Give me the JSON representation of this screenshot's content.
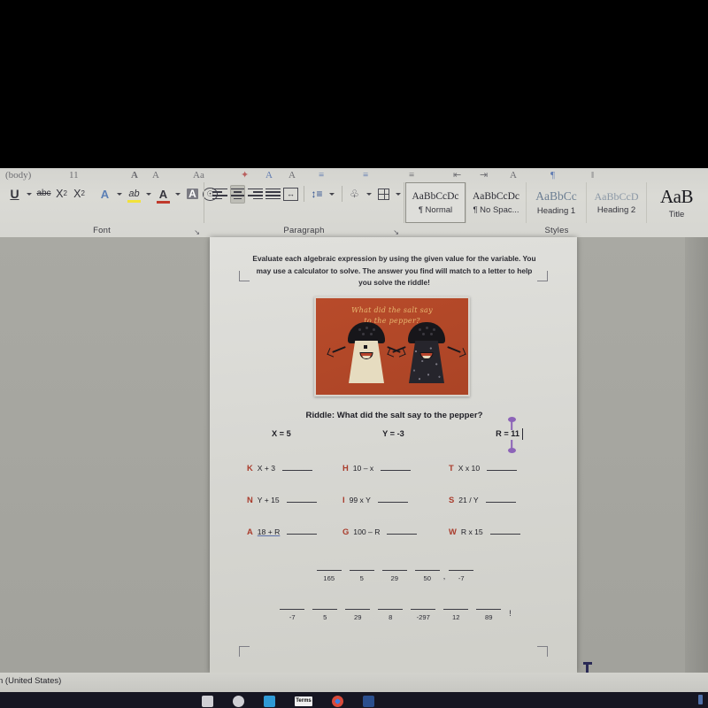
{
  "app": {
    "name": "Microsoft Word",
    "ribbon_cut_hint": "(body)"
  },
  "ribbon": {
    "groups": [
      {
        "name": "Font",
        "label": "Font",
        "dialog_launcher": "↘",
        "items": [
          {
            "icon": "underline-icon",
            "label": "U"
          },
          {
            "icon": "strikethrough-icon",
            "label": "abc"
          },
          {
            "icon": "subscript-icon",
            "label": "X"
          },
          {
            "icon": "superscript-icon",
            "label": "X"
          },
          {
            "icon": "text-effects-icon",
            "label": "A"
          },
          {
            "icon": "text-highlight-color-icon",
            "label": "ab"
          },
          {
            "icon": "font-color-icon",
            "label": "A"
          },
          {
            "icon": "character-shading-icon",
            "label": "A"
          },
          {
            "icon": "phonetic-guide-icon",
            "label": "♁"
          }
        ]
      },
      {
        "name": "Paragraph",
        "label": "Paragraph",
        "dialog_launcher": "↘",
        "items": [
          {
            "icon": "align-left-icon",
            "label": ""
          },
          {
            "icon": "align-center-icon",
            "label": ""
          },
          {
            "icon": "align-right-icon",
            "label": ""
          },
          {
            "icon": "justify-icon",
            "label": ""
          },
          {
            "icon": "distributed-icon",
            "label": "↔"
          },
          {
            "icon": "line-spacing-icon",
            "label": "↕"
          },
          {
            "icon": "shading-icon",
            "label": "◢"
          },
          {
            "icon": "borders-icon",
            "label": ""
          }
        ]
      },
      {
        "name": "Styles",
        "label": "Styles"
      }
    ],
    "styles": [
      {
        "preview": "AaBbCcDc",
        "name": "¶ Normal",
        "selected": true,
        "kind": "body"
      },
      {
        "preview": "AaBbCcDc",
        "name": "¶ No Spac...",
        "selected": false,
        "kind": "body"
      },
      {
        "preview": "AaBbCc",
        "name": "Heading 1",
        "selected": false,
        "kind": "h1"
      },
      {
        "preview": "AaBbCcD",
        "name": "Heading 2",
        "selected": false,
        "kind": "h2"
      },
      {
        "preview": "AaB",
        "name": "Title",
        "selected": false,
        "kind": "title"
      }
    ]
  },
  "document": {
    "intro": "Evaluate each algebraic expression by using the given value for the variable.  You may use a calculator to solve.  The answer you find will match to a letter to help you solve the riddle!",
    "picture": {
      "alt": "salt-and-pepper-shakers-cartoon",
      "script_line1": "What did the salt say",
      "script_line2": "to the pepper?",
      "background_color": "#b0472a",
      "script_color": "#e8b870",
      "salt_body_color": "#e6dcc0",
      "pepper_body_color": "#26252c",
      "cap_color": "#17161a"
    },
    "riddle_question": "Riddle:  What did the salt say to the pepper?",
    "variables": [
      {
        "name": "X",
        "value": "X = 5"
      },
      {
        "name": "Y",
        "value": "Y = -3"
      },
      {
        "name": "R",
        "value": "R = 11",
        "has_caret": true
      }
    ],
    "problems": [
      [
        {
          "letter": "K",
          "expression": "X + 3"
        },
        {
          "letter": "H",
          "expression": "10 – x"
        },
        {
          "letter": "T",
          "expression": "X x 10"
        }
      ],
      [
        {
          "letter": "N",
          "expression": "Y + 15"
        },
        {
          "letter": "I",
          "expression": "99 x Y"
        },
        {
          "letter": "S",
          "expression": "21 / Y"
        }
      ],
      [
        {
          "letter": "A",
          "expression": "18 + R",
          "underline_tail": "R"
        },
        {
          "letter": "G",
          "expression": "100 – R"
        },
        {
          "letter": "W",
          "expression": "R x 15"
        }
      ]
    ],
    "answer_lines": [
      {
        "numbers": [
          "165",
          "5",
          "29",
          "50",
          "-7"
        ],
        "punct_after_index": 3,
        "punct": ",",
        "terminator": ""
      },
      {
        "numbers": [
          "-7",
          "5",
          "29",
          "8",
          "-297",
          "12",
          "89"
        ],
        "punct_after_index": -1,
        "punct": "",
        "terminator": "!"
      }
    ],
    "letter_color": "#a93b2b",
    "underline_color": "#5a6ea8"
  },
  "cursor": {
    "type": "i-beam",
    "color": "#2a2a55"
  },
  "selection_handles": {
    "color": "#8c63b8"
  },
  "status_bar": {
    "language": "n (United States)"
  },
  "taskbar": {
    "items": [
      {
        "icon": "windows-start-icon"
      },
      {
        "icon": "cortana-circle-icon"
      },
      {
        "icon": "blue-app-icon"
      },
      {
        "icon": "terms-app-icon",
        "label": "Terms"
      },
      {
        "icon": "chrome-icon"
      },
      {
        "icon": "docs-app-icon"
      }
    ]
  }
}
